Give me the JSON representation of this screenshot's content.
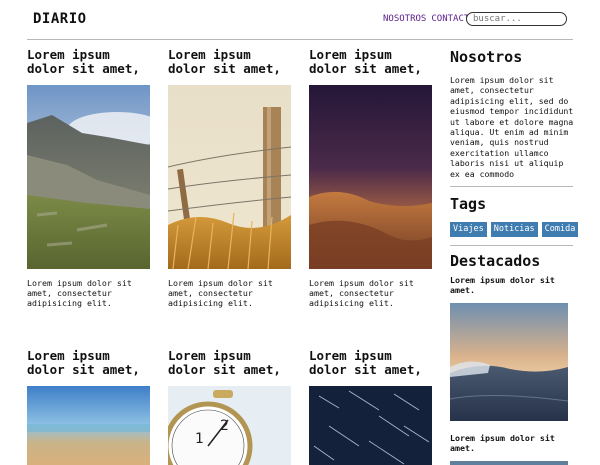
{
  "header": {
    "logo": "DIARIO",
    "nav": [
      "NOSOTROS",
      "CONTACTO"
    ],
    "search_placeholder": "buscar..."
  },
  "posts": [
    {
      "title": "Lorem ipsum dolor sit amet,",
      "text": "Lorem ipsum dolor sit amet, consectetur adipisicing elit.",
      "image": "mountain-photo"
    },
    {
      "title": "Lorem ipsum dolor sit amet,",
      "text": "Lorem ipsum dolor sit amet, consectetur adipisicing elit.",
      "image": "fence-photo"
    },
    {
      "title": "Lorem ipsum dolor sit amet,",
      "text": "Lorem ipsum dolor sit amet, consectetur adipisicing elit.",
      "image": "desert-dusk-photo"
    },
    {
      "title": "Lorem ipsum dolor sit amet,",
      "image": "beach-photo"
    },
    {
      "title": "Lorem ipsum dolor sit amet,",
      "image": "clock-photo"
    },
    {
      "title": "Lorem ipsum dolor sit amet,",
      "image": "star-trails-photo"
    }
  ],
  "sidebar": {
    "about_title": "Nosotros",
    "about_text": "Lorem ipsum dolor sit amet, consectetur adipisicing elit, sed do eiusmod tempor incididunt ut labore et dolore magna aliqua. Ut enim ad minim veniam, quis nostrud exercitation ullamco laboris nisi ut aliquip ex ea commodo",
    "tags_title": "Tags",
    "tags": [
      "Viajes",
      "Noticias",
      "Comida"
    ],
    "featured_title": "Destacados",
    "featured": [
      {
        "title": "Lorem ipsum dolor sit amet.",
        "image": "sea-sunset-photo"
      },
      {
        "title": "Lorem ipsum dolor sit amet.",
        "image": "featured-photo-2"
      }
    ]
  },
  "colors": {
    "accent_tag": "#3f7cb0",
    "nav_link": "#5a1d8c"
  }
}
